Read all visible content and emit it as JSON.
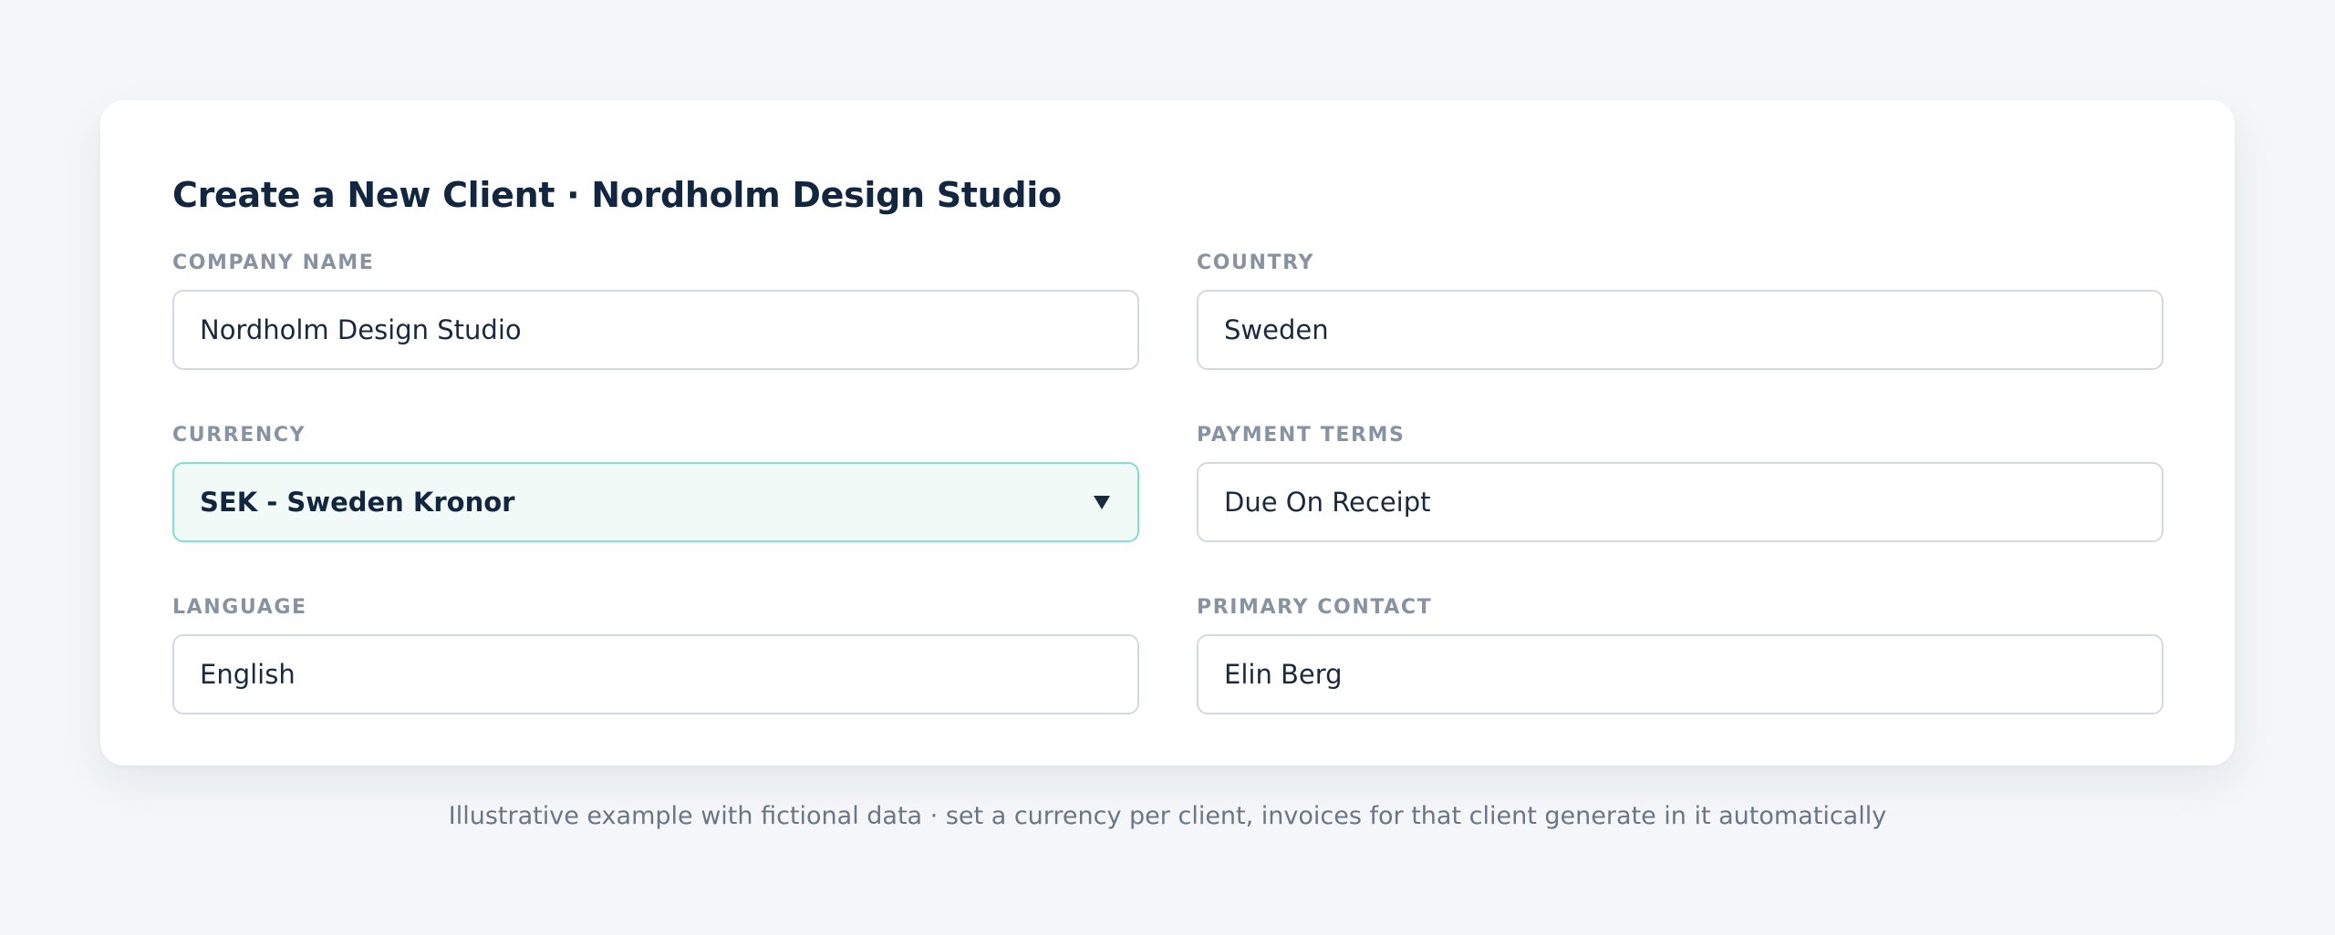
{
  "form": {
    "title": "Create a New Client · Nordholm Design Studio",
    "fields": [
      {
        "label": "COMPANY NAME",
        "value": "Nordholm Design Studio"
      },
      {
        "label": "COUNTRY",
        "value": "Sweden"
      },
      {
        "label": "CURRENCY",
        "value": "SEK - Sweden Kronor"
      },
      {
        "label": "PAYMENT TERMS",
        "value": "Due On Receipt"
      },
      {
        "label": "LANGUAGE",
        "value": "English"
      },
      {
        "label": "PRIMARY CONTACT",
        "value": "Elin Berg"
      }
    ]
  },
  "footnote": "Illustrative example with fictional data · set a currency per client, invoices for that client generate in it automatically",
  "icons": {
    "currency_dropdown": "caret-down-icon"
  },
  "colors": {
    "background": "#f4f6f9",
    "card": "#ffffff",
    "title": "#12263f",
    "label": "#8893a2",
    "input_border": "#d4d9e0",
    "selected_border": "#7fe0cf",
    "selected_fill": "#f2faf8"
  }
}
